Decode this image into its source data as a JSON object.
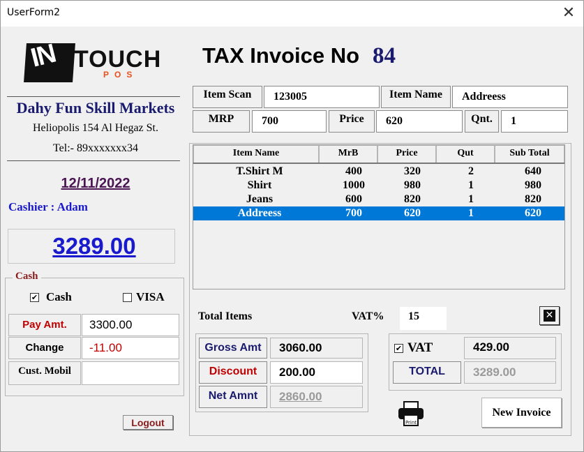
{
  "window": {
    "title": "UserForm2",
    "close_glyph": "✕"
  },
  "logo": {
    "main": "IN",
    "touch": "TOUCH",
    "sub": "POS",
    "brand_color": "#e8501d"
  },
  "store": {
    "name": "Dahy Fun Skill Markets",
    "address": "Heliopolis 154 Al Hegaz St.",
    "tel": "Tel:- 89xxxxxxx34"
  },
  "date": "12/11/2022",
  "cashier": "Cashier : Adam",
  "grand_total_display": "3289.00",
  "payment": {
    "group_label": "Cash",
    "cash_label": "Cash",
    "cash_checked": true,
    "visa_label": "VISA",
    "visa_checked": false,
    "pay_amt_label": "Pay Amt.",
    "pay_amt_value": "3300.00",
    "change_label": "Change",
    "change_value": "-11.00",
    "cust_mobil_label": "Cust. Mobil",
    "cust_mobil_value": ""
  },
  "logout_label": "Logout",
  "invoice": {
    "title": "TAX Invoice No",
    "number": "84"
  },
  "entry": {
    "item_scan_label": "Item Scan",
    "item_scan_value": "123005",
    "item_name_label": "Item Name",
    "item_name_value": "Addreess",
    "mrp_label": "MRP",
    "mrp_value": "700",
    "price_label": "Price",
    "price_value": "620",
    "qnt_label": "Qnt.",
    "qnt_value": "1"
  },
  "table": {
    "columns": [
      "Item Name",
      "MrB",
      "Price",
      "Qut",
      "Sub Total"
    ],
    "rows": [
      [
        "T.Shirt M",
        "400",
        "320",
        "2",
        "640"
      ],
      [
        "Shirt",
        "1000",
        "980",
        "1",
        "980"
      ],
      [
        "Jeans",
        "600",
        "820",
        "1",
        "820"
      ],
      [
        "Addreess",
        "700",
        "620",
        "1",
        "620"
      ]
    ],
    "selected_row": 3
  },
  "totals": {
    "total_items_label": "Total Items",
    "vat_pct_label": "VAT%",
    "vat_pct_value": "15",
    "gross_label": "Gross Amt",
    "gross_value": "3060.00",
    "discount_label": "Discount",
    "discount_value": "200.00",
    "net_label": "Net Amnt",
    "net_value": "2860.00",
    "vat_label": "VAT",
    "vat_checked": true,
    "vat_value": "429.00",
    "total_label": "TOTAL",
    "total_value": "3289.00"
  },
  "print_icon_text": "Print",
  "new_invoice_label": "New Invoice",
  "colors": {
    "navy": "#1a1a6e",
    "blue": "#1a1acd",
    "maroon": "#8b1a1a",
    "red": "#c00000",
    "select": "#0078d7"
  }
}
